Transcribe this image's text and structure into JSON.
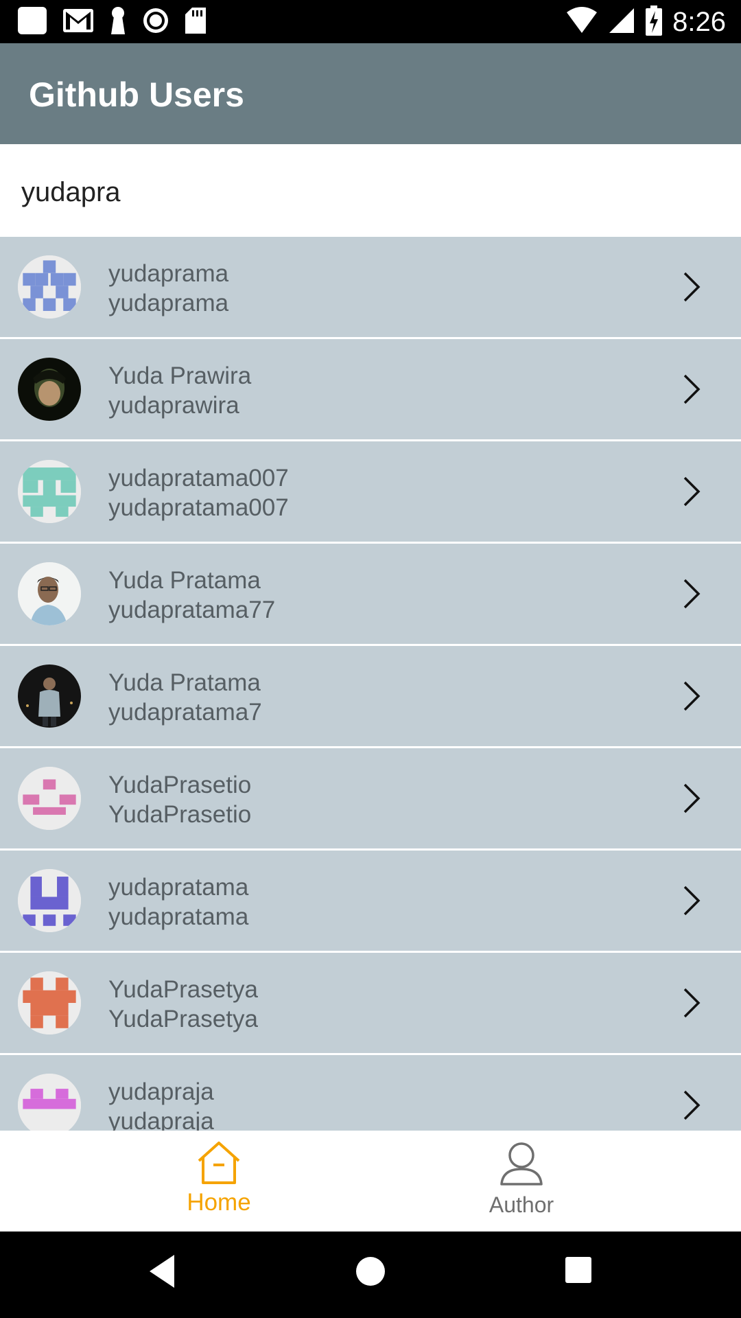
{
  "status_bar": {
    "time": "8:26",
    "left_icons": [
      "app-icon",
      "gmail-icon",
      "keyhole-icon",
      "radio-icon",
      "sd-card-icon"
    ],
    "right_icons": [
      "wifi-icon",
      "signal-icon",
      "battery-charging-icon"
    ]
  },
  "app_bar": {
    "title": "Github Users"
  },
  "search": {
    "value": "yudapra"
  },
  "users": [
    {
      "name": "yudaprama",
      "login": "yudaprama",
      "avatar": "identicon",
      "color": "#7a92d6"
    },
    {
      "name": "Yuda Prawira",
      "login": "yudaprawira",
      "avatar": "photo",
      "color": "#1c2a18"
    },
    {
      "name": "yudapratama007",
      "login": "yudapratama007",
      "avatar": "identicon",
      "color": "#7ccdbd"
    },
    {
      "name": "Yuda Pratama",
      "login": "yudapratama77",
      "avatar": "photo",
      "color": "#e7ecee"
    },
    {
      "name": "Yuda Pratama",
      "login": "yudapratama7",
      "avatar": "photo",
      "color": "#1a1a1a"
    },
    {
      "name": "YudaPrasetio",
      "login": "YudaPrasetio",
      "avatar": "identicon",
      "color": "#d977b0"
    },
    {
      "name": "yudapratama",
      "login": "yudapratama",
      "avatar": "identicon",
      "color": "#6a62d0"
    },
    {
      "name": "YudaPrasetya",
      "login": "YudaPrasetya",
      "avatar": "identicon",
      "color": "#e0714f"
    },
    {
      "name": "yudapraja",
      "login": "yudapraja",
      "avatar": "identicon",
      "color": "#d66cdb"
    }
  ],
  "bottom_nav": {
    "items": [
      {
        "label": "Home",
        "icon": "home-icon",
        "active": true,
        "color": "#f5a300"
      },
      {
        "label": "Author",
        "icon": "person-icon",
        "active": false,
        "color": "#6f6f6f"
      }
    ]
  },
  "colors": {
    "app_bar": "#6a7d84",
    "row_bg": "#c2ced5",
    "row_text": "#565e63",
    "accent": "#f5a300"
  }
}
